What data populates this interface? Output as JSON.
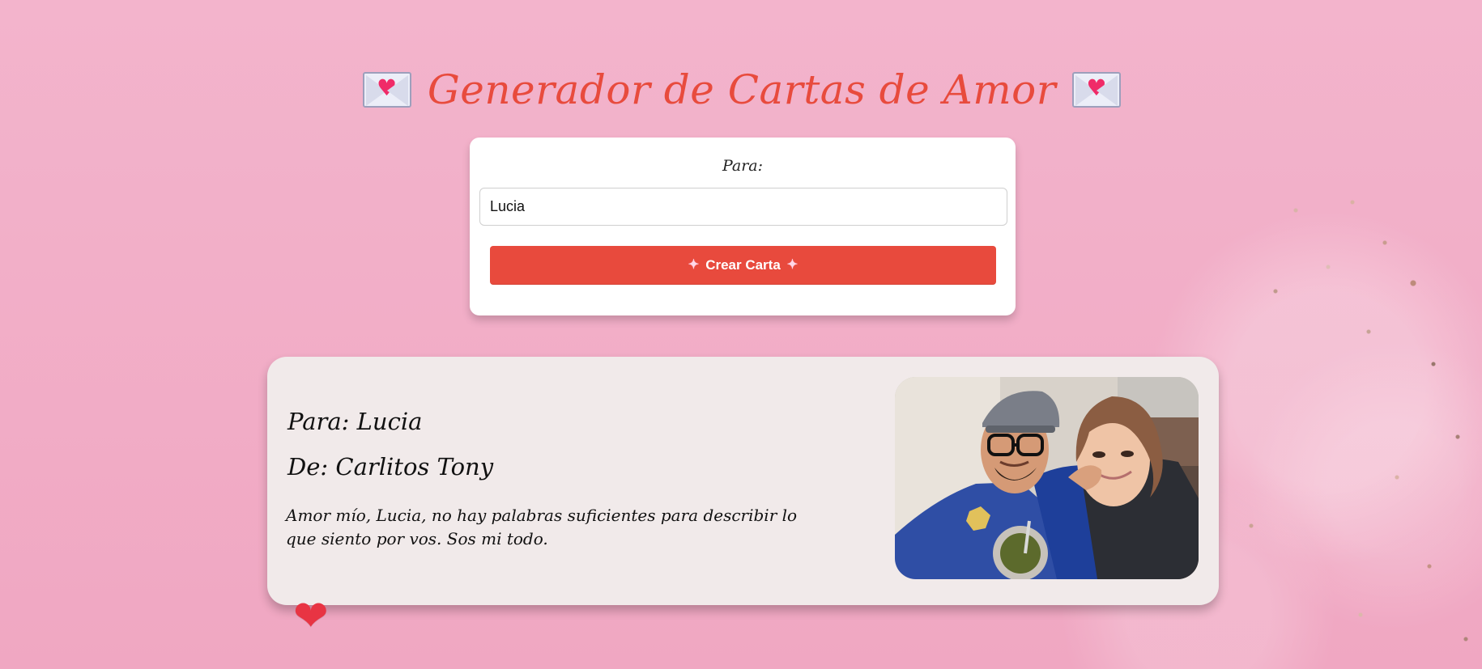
{
  "header": {
    "title": "Generador de Cartas de Amor",
    "left_icon": "envelope-heart-icon",
    "right_icon": "envelope-heart-icon"
  },
  "form": {
    "label": "Para:",
    "input_value": "Lucia",
    "button_label": "Crear Carta",
    "button_left_icon": "sparkling-heart-icon",
    "button_right_icon": "sparkling-heart-icon"
  },
  "letter": {
    "to_line": "Para: Lucia",
    "from_line": "De: Carlitos Tony",
    "message": "Amor mío, Lucia, no hay palabras suficientes para describir lo que siento por vos. Sos mi todo.",
    "photo_icon": "couple-photo"
  },
  "decorations": {
    "bottom_icon": "heart-icon"
  },
  "colors": {
    "title": "#e84b3d",
    "button": "#e84a3d",
    "letter_bg": "#f1eaea",
    "page_bg": "#f0a7c2"
  }
}
